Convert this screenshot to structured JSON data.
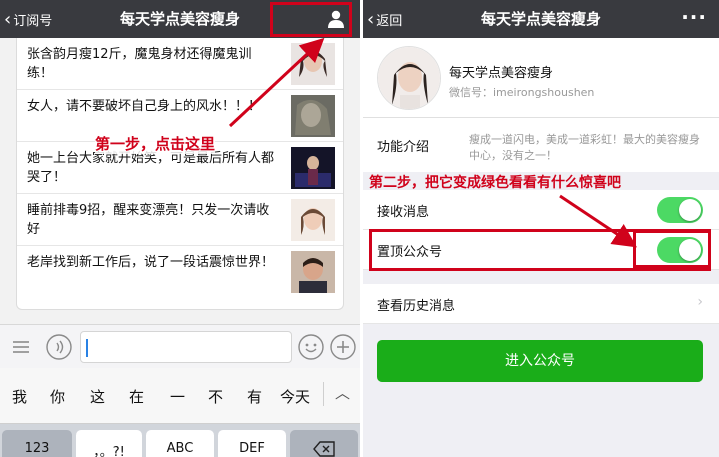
{
  "left_screen": {
    "nav": {
      "back_label": "订阅号",
      "title": "每天学点美容瘦身"
    },
    "articles": [
      {
        "title": "张含韵月瘦12斤，魔鬼身材还得魔鬼训练！"
      },
      {
        "title": "女人，请不要破坏自己身上的风水！！！"
      },
      {
        "title": "她一上台大家就开始笑，可是最后所有人都哭了！"
      },
      {
        "title": "睡前排毒9招，醒来变漂亮！只发一次请收好"
      },
      {
        "title": "老岸找到新工作后，说了一段话震惊世界！"
      }
    ],
    "annotation_step1": "第一步，点击这里",
    "keyboard": {
      "candidates": [
        "我",
        "你",
        "这",
        "在",
        "一",
        "不",
        "有",
        "今天"
      ],
      "keys": [
        "123",
        "，。?!",
        "ABC",
        "DEF"
      ]
    }
  },
  "right_screen": {
    "nav": {
      "back_label": "返回",
      "title": "每天学点美容瘦身"
    },
    "profile": {
      "name": "每天学点美容瘦身",
      "wechat_id": "微信号：imeirongshoushen"
    },
    "intro": {
      "label": "功能介绍",
      "text": "瘦成一道闪电，美成一道彩虹！最大的美容瘦身中心，没有之一！"
    },
    "annotation_step2": "第二步，把它变成绿色看看有什么惊喜吧",
    "settings": {
      "receive_messages": {
        "label": "接收消息",
        "on": true
      },
      "pin_account": {
        "label": "置顶公众号",
        "on": true
      },
      "history": {
        "label": "查看历史消息"
      }
    },
    "enter_button": "进入公众号"
  },
  "colors": {
    "nav_bg": "#393a3f",
    "annotation_red": "#d0021b",
    "toggle_green": "#4cd964",
    "button_green": "#1aad19"
  }
}
